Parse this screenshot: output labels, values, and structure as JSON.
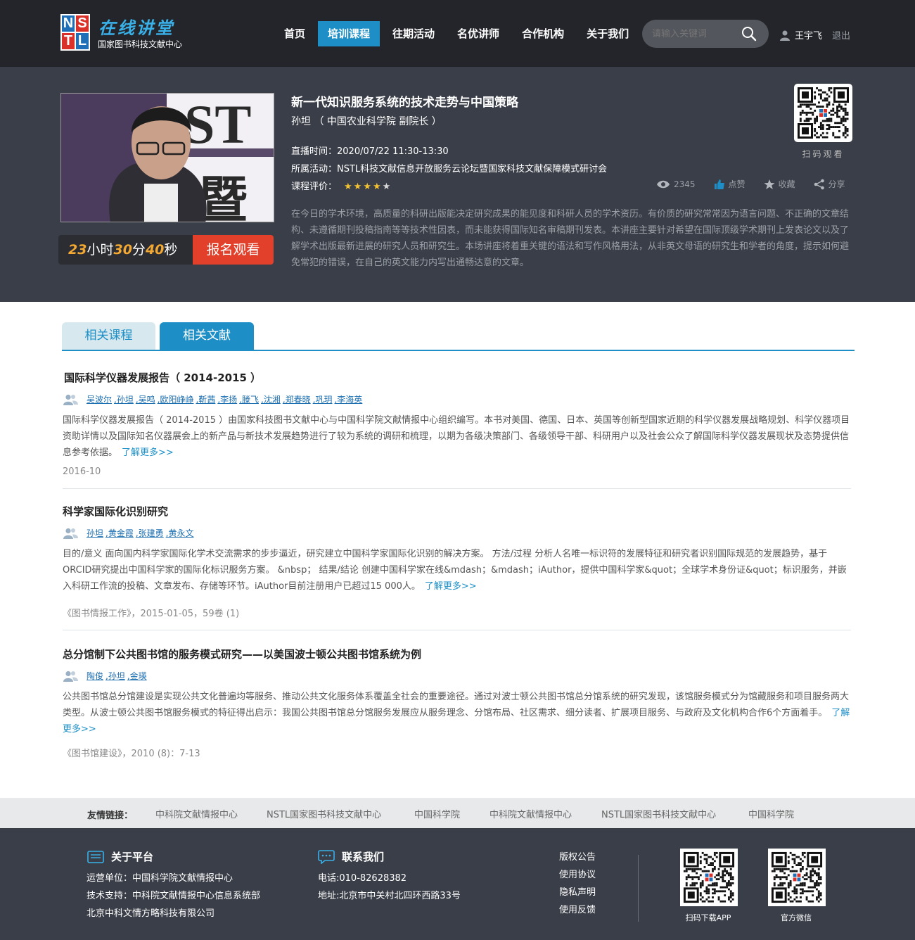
{
  "header": {
    "logo_letters": [
      "N",
      "S",
      "T",
      "L"
    ],
    "logo_title": "在线讲堂",
    "logo_subtitle": "国家图书科技文献中心",
    "nav": [
      "首页",
      "培训课程",
      "往期活动",
      "名优讲师",
      "合作机构",
      "关于我们"
    ],
    "active_nav": "培训课程",
    "search_placeholder": "请输入关键词",
    "username": "王宇飞",
    "logout": "退出"
  },
  "course": {
    "title": "新一代知识服务系统的技术走势与中国策略",
    "speaker": "孙坦 （ 中国农业科学院  副院长 ）",
    "live_time_label": "直播时间：",
    "live_time": "2020/07/22  11:30-13:30",
    "activity_label": "所属活动：",
    "activity": "NSTL科技文献信息开放服务云论坛暨国家科技文献保障模式研讨会",
    "rating_label": "课程评价：",
    "rating": 4,
    "rating_stars": "★★★★★",
    "views": "2345",
    "like": "点赞",
    "favorite": "收藏",
    "share": "分享",
    "qr_label": "扫码观看",
    "description": "在今日的学术环境，高质量的科研出版能决定研究成果的能见度和科研人员的学术资历。有价质的研究常常因为语言问题、不正确的文章结构、未遵循期刊投稿指南等等技术性因表，而未能获得国际知名审稿期刊发表。本讲座主要针对希望在国际顶级学术期刊上发表论文以及了解学术出版最新进展的研究人员和研究生。本场讲座将着重关键的语法和写作风格用法，从非英文母语的研究生和学者的角度，提示如何避免常犯的错误，在自己的英文能力内写出通畅达意的文章。",
    "countdown": {
      "hours": "23",
      "h_unit": "小时",
      "minutes": "30",
      "m_unit": "分",
      "seconds": "40",
      "s_unit": "秒"
    },
    "signup": "报名观看",
    "photo_text": "ST 暨"
  },
  "tabs": [
    "相关课程",
    "相关文献"
  ],
  "active_tab": "相关文献",
  "documents": [
    {
      "title": "国际科学仪器发展报告（ 2014-2015 ）",
      "authors": [
        "吴波尔",
        ",孙坦",
        ",吴鸣",
        ",欧阳峥峥",
        ",靳茜",
        ",李扬",
        ",滕飞",
        ",沈湘",
        ",郑春晓",
        ",巩玥",
        ",李海英"
      ],
      "abstract": "国际科学仪器发展报告（ 2014-2015 ）由国家科技图书文献中心与中国科学院文献情报中心组织编写。本书对美国、德国、日本、英国等创新型国家近期的科学仪器发展战略规划、科学仪器项目资助详情以及国际知名仪器展会上的新产品与新技术发展趋势进行了较为系统的调研和梳理，以期为各级决策部门、各级领导干部、科研用户以及社会公众了解国际科学仪器发展现状及态势提供信息参考依据。",
      "more": "了解更多>>",
      "source": "2016-10"
    },
    {
      "title": "科学家国际化识别研究",
      "authors": [
        "孙坦",
        ",黄金霞",
        ",张建勇",
        ",黄永文"
      ],
      "abstract": "目的/意义 面向国内科学家国际化学术交流需求的步步逼近，研究建立中国科学家国际化识别的解决方案。 方法/过程 分析人名唯一标识符的发展特征和研究者识别国际规范的发展趋势，基于ORCID研究提出中国科学家的国际化标识服务方案。 &nbsp； 结果/结论 创建中国科学家在线&mdash；&mdash；iAuthor，提供中国科学家&quot；全球学术身份证&quot；标识服务，并嵌入科研工作流的投稿、文章发布、存储等环节。iAuthor目前注册用户已超过15 000人。",
      "more": "了解更多>>",
      "source": "《图书情报工作》，2015-01-05，59卷 (1)"
    },
    {
      "title": "总分馆制下公共图书馆的服务模式研究——以美国波士顿公共图书馆系统为例",
      "authors": [
        "陶俊",
        ",孙坦",
        ",金瑛"
      ],
      "abstract": "公共图书馆总分馆建设是实现公共文化普遍均等服务、推动公共文化服务体系覆盖全社会的重要途径。通过对波士顿公共图书馆总分馆系统的研究发现，该馆服务模式分为馆藏服务和项目服务两大类型。从波士顿公共图书馆服务模式的特征得出启示：我国公共图书馆总分馆服务发展应从服务理念、分馆布局、社区需求、细分读者、扩展项目服务、与政府及文化机构合作6个方面着手。",
      "more": "了解更多>>",
      "source": "《图书馆建设》，2010 (8)：7-13"
    }
  ],
  "friend_links": {
    "label": "友情链接：",
    "items": [
      "中科院文献情报中心",
      "NSTL国家图书科技文献中心",
      "中国科学院",
      "中科院文献情报中心",
      "NSTL国家图书科技文献中心",
      "中国科学院"
    ]
  },
  "footer": {
    "about": {
      "title": "关于平台",
      "lines": [
        "运营单位：中国科学院文献情报中心",
        "技术支持：中科院文献情报中心信息系统部",
        "北京中科文情方略科技有限公司"
      ]
    },
    "contact": {
      "title": "联系我们",
      "lines": [
        "电话:010-82628382",
        "地址:北京市中关村北四环西路33号"
      ]
    },
    "links": [
      "版权公告",
      "使用协议",
      "隐私声明",
      "使用反馈"
    ],
    "qr": [
      "扫码下载APP",
      "官方微信"
    ]
  },
  "colors": {
    "accent": "#1d8fc6",
    "header_bg": "#23252a",
    "hero_bg": "#3a3e48",
    "signup": "#e2402a",
    "countdown_num": "#f2a833"
  }
}
